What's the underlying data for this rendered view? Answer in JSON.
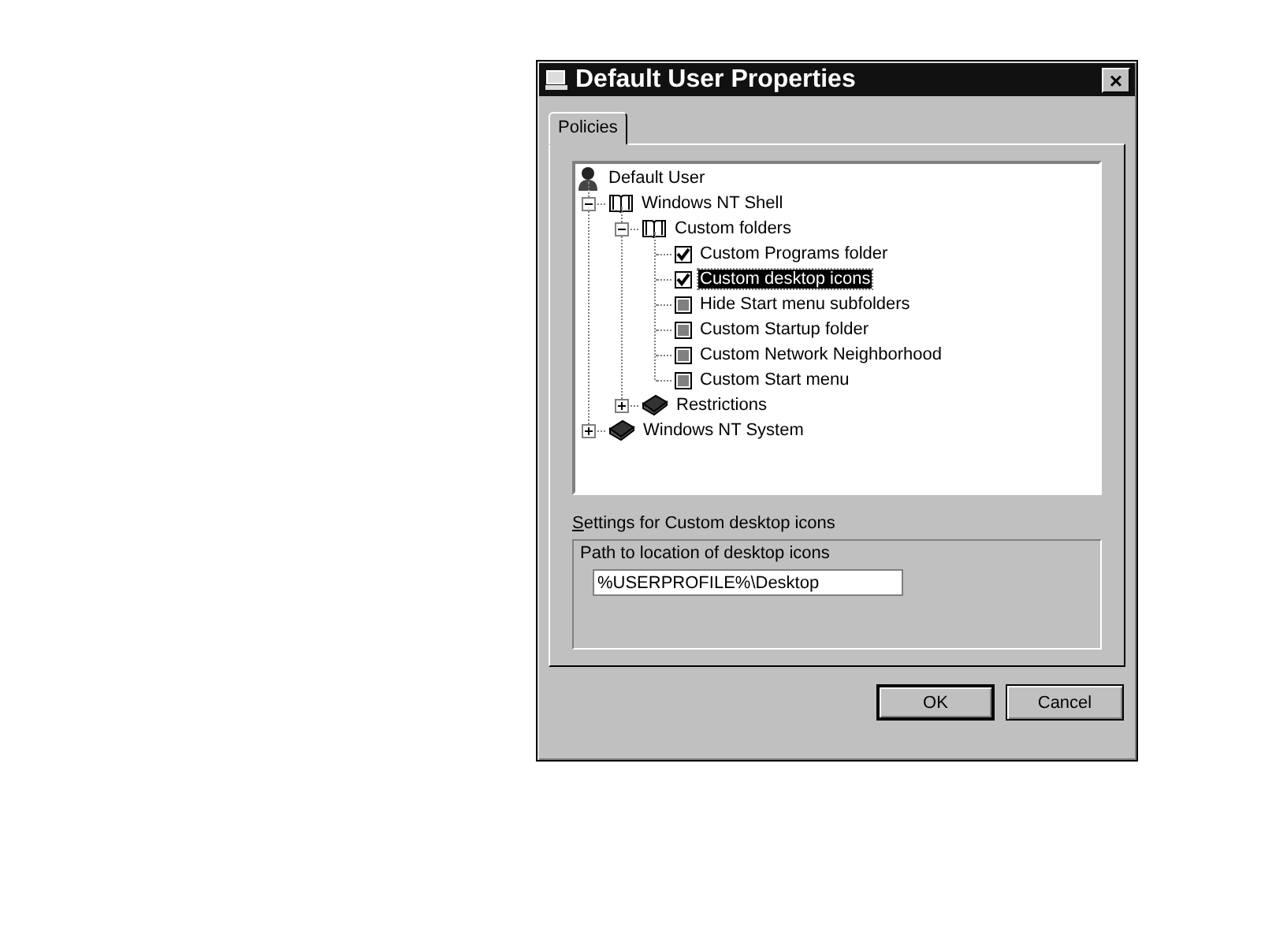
{
  "window": {
    "title": "Default User Properties",
    "close": "×"
  },
  "tabs": [
    {
      "label": "Policies",
      "selected": true
    }
  ],
  "tree": [
    {
      "label": "Default User",
      "kind": "user",
      "selected": false,
      "children": [
        {
          "label": "Windows NT Shell",
          "kind": "book",
          "selected": false,
          "expanded": true,
          "children": [
            {
              "label": "Custom folders",
              "kind": "book",
              "selected": false,
              "expanded": true,
              "children": [
                {
                  "label": "Custom Programs folder",
                  "kind": "policy",
                  "checked": true,
                  "selected": false
                },
                {
                  "label": "Custom desktop icons",
                  "kind": "policy",
                  "checked": true,
                  "selected": true
                },
                {
                  "label": "Hide Start menu subfolders",
                  "kind": "policy",
                  "checked": false,
                  "selected": false
                },
                {
                  "label": "Custom Startup folder",
                  "kind": "policy",
                  "checked": false,
                  "selected": false
                },
                {
                  "label": "Custom Network Neighborhood",
                  "kind": "policy",
                  "checked": false,
                  "selected": false
                },
                {
                  "label": "Custom Start menu",
                  "kind": "policy",
                  "checked": false,
                  "selected": false
                }
              ]
            },
            {
              "label": "Restrictions",
              "kind": "book",
              "selected": false,
              "expanded": false
            }
          ]
        },
        {
          "label": "Windows NT System",
          "kind": "book",
          "selected": false,
          "expanded": false
        }
      ]
    }
  ],
  "settings": {
    "title": "Settings for Custom desktop icons",
    "field_label": "Path to location of desktop icons",
    "value": "%USERPROFILE%\\Desktop"
  },
  "buttons": [
    {
      "label": "OK",
      "default": true
    },
    {
      "label": "Cancel",
      "default": false
    }
  ]
}
